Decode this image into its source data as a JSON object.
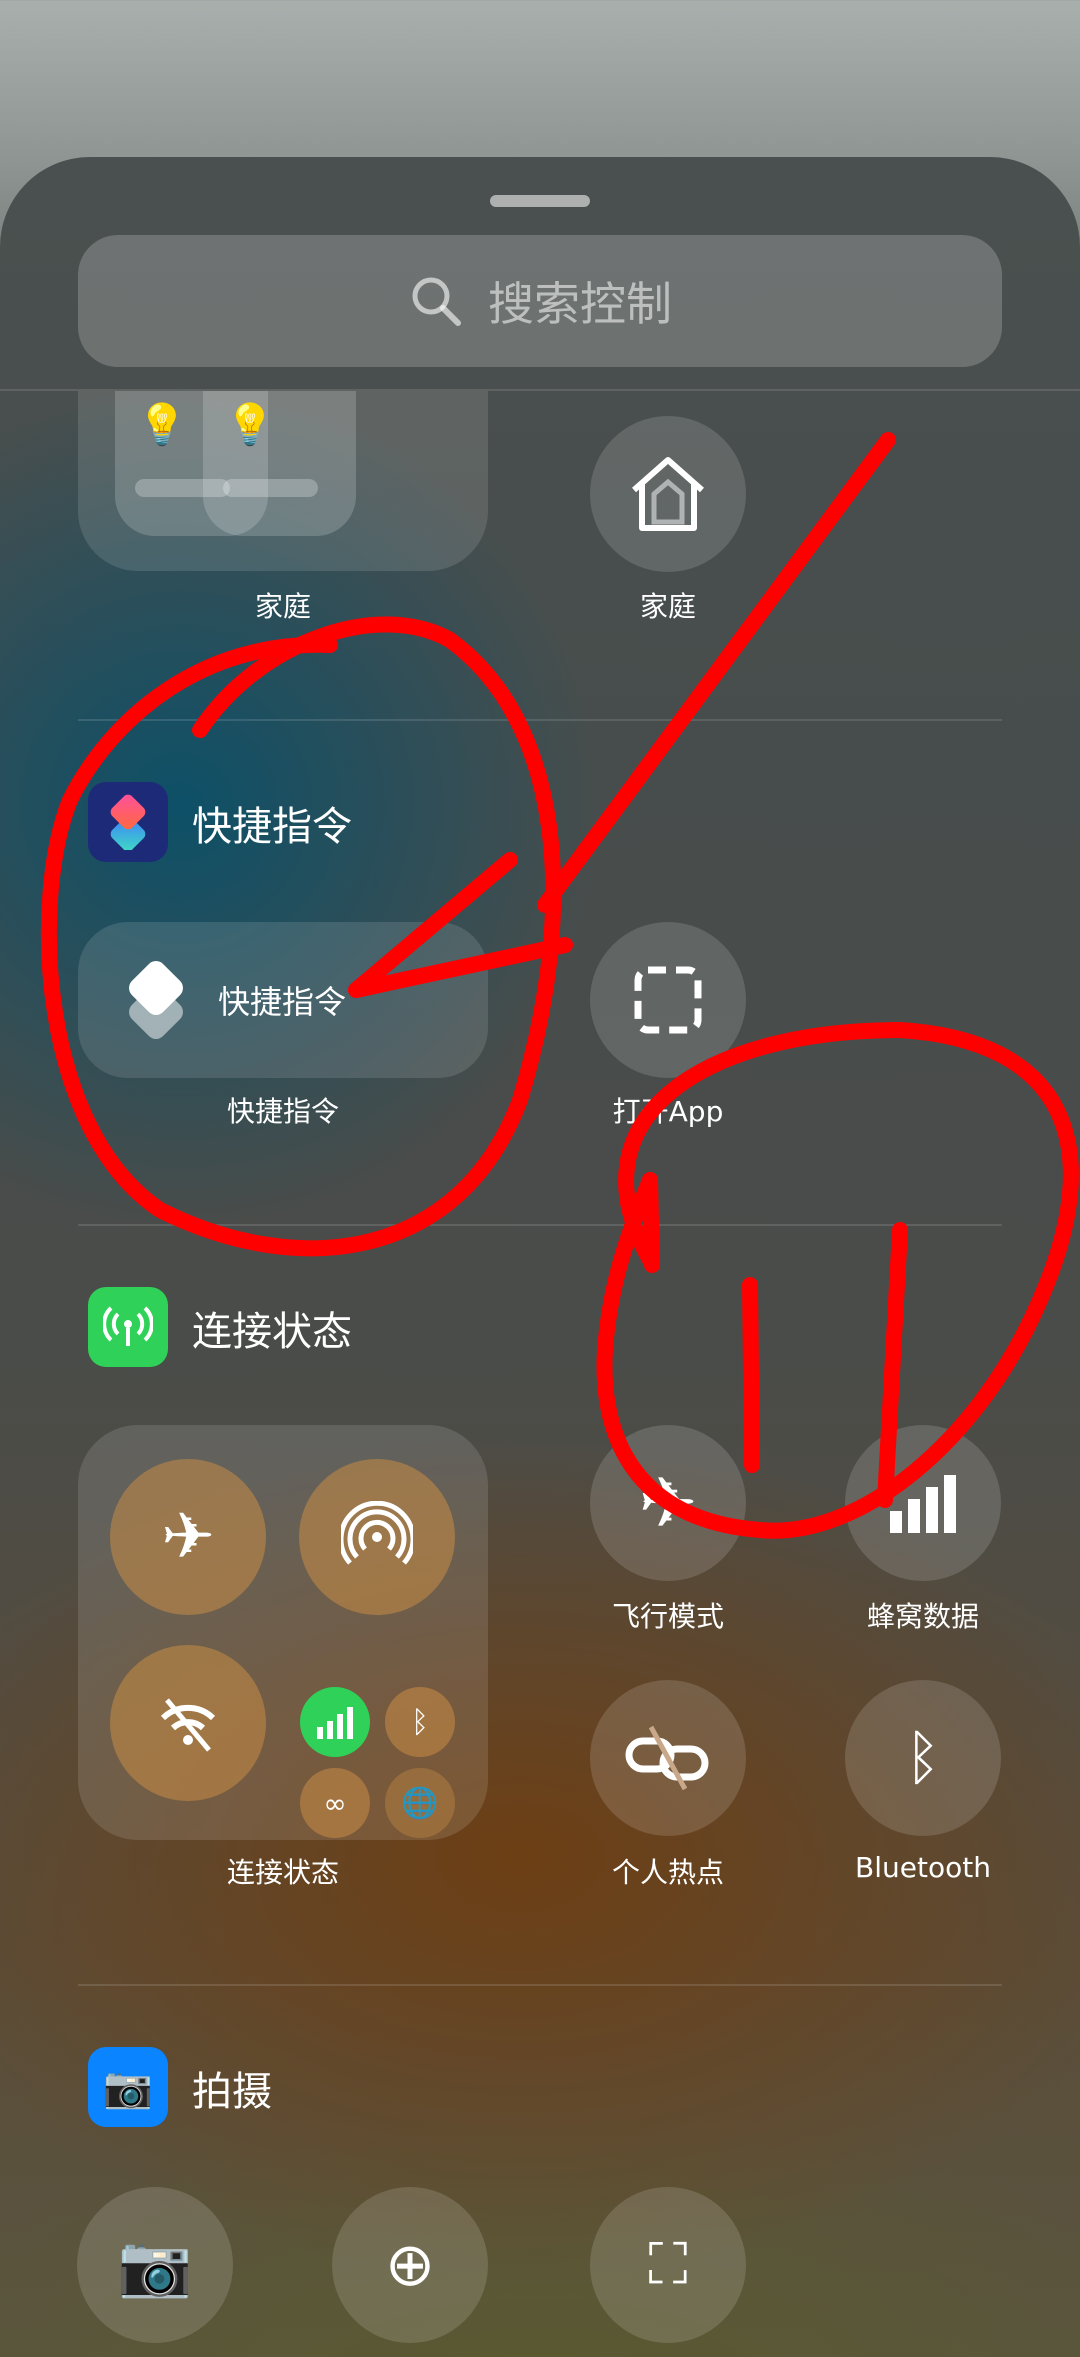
{
  "search": {
    "placeholder": "搜索控制",
    "icon": "search-icon"
  },
  "home": {
    "widget_label": "家庭",
    "button_label": "家庭"
  },
  "shortcuts": {
    "section_title": "快捷指令",
    "widget_text": "快捷指令",
    "widget_label": "快捷指令",
    "open_app_label": "打开App"
  },
  "connectivity": {
    "section_title": "连接状态",
    "widget_label": "连接状态",
    "airplane_label": "飞行模式",
    "cellular_label": "蜂窝数据",
    "hotspot_label": "个人热点",
    "bluetooth_label": "Bluetooth",
    "colors": {
      "accent_green": "#30d158",
      "connectivity_bg": "#b07a3e"
    }
  },
  "camera": {
    "section_title": "拍摄",
    "color": "#0a84ff"
  },
  "annotation_color": "#ff0000"
}
